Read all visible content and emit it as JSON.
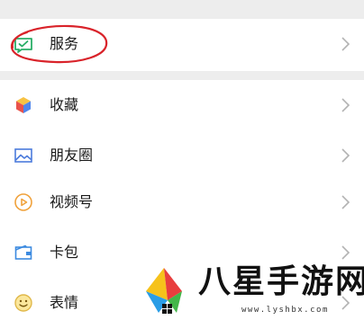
{
  "menu": {
    "service": {
      "label": "服务",
      "icon": "wechat-pay-icon"
    },
    "items": [
      {
        "label": "收藏",
        "icon": "favorites-cube-icon"
      },
      {
        "label": "朋友圈",
        "icon": "moments-image-icon"
      },
      {
        "label": "视频号",
        "icon": "channels-play-icon"
      },
      {
        "label": "卡包",
        "icon": "card-wallet-icon"
      },
      {
        "label": "表情",
        "icon": "emoji-smile-icon"
      }
    ]
  },
  "watermark": {
    "title": "八星手游网",
    "url": "www.lyshbx.com"
  },
  "colors": {
    "annotation": "#d9232a",
    "separator": "#ededed",
    "chevron": "#b2b2b2",
    "text": "#191919"
  }
}
